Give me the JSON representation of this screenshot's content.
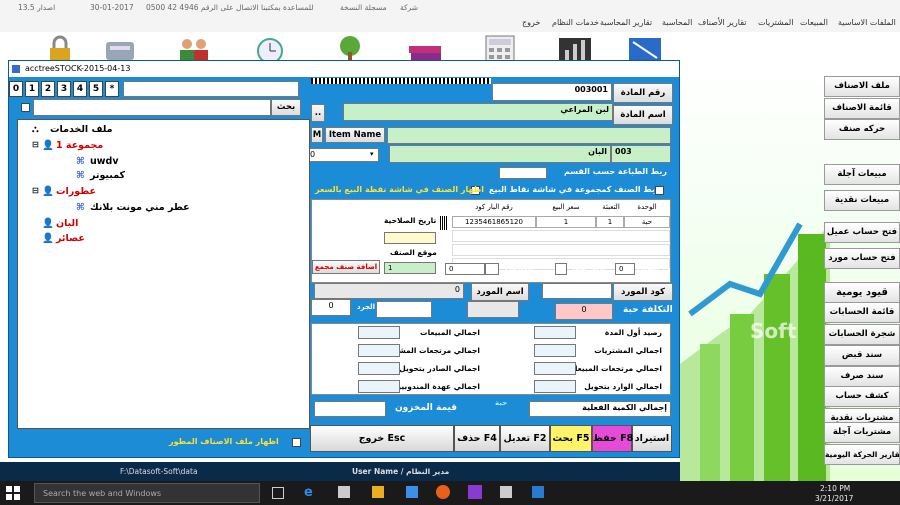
{
  "app_topbar": {
    "version": "اصدار  13.5",
    "date": "30-01-2017",
    "support": "للمساعدة بمكتبنا الاتصال على الرقم 4946 42 0500",
    "copy_label": "مسجلة النسخة",
    "company": "شركة"
  },
  "app_menu": [
    "الملفات الاساسية",
    "المبيعات",
    "المشتريات",
    "تقارير الأصناف",
    "المحاسبة",
    "تقارير المحاسبة",
    "خدمات النظام",
    "خروج"
  ],
  "right_buttons": [
    "ملف الاصناف",
    "قائمة الاصناف",
    "حركه صنف",
    "مبيعات آجلة",
    "مبيعات نقدية",
    "فتح حساب عميل",
    "فتح حساب مورد",
    "قيود يومية",
    "قائمة الحسابات",
    "شجرة الحسابات",
    "سند قبض",
    "سند صرف",
    "كشف حساب",
    "مشتريات نقدية",
    "مشتريات آجلة",
    "تقارير الحركة اليومية"
  ],
  "watermark": "Soft",
  "dialog": {
    "title": "acctreeSTOCK-2015-04-13",
    "num_keys": [
      "0",
      "1",
      "2",
      "3",
      "4",
      "5",
      "*"
    ],
    "search_button": "بحث",
    "tree": {
      "root": "ملف الخدمات",
      "items": [
        {
          "label": "مجموعة 1",
          "color": "#d40000"
        },
        {
          "label": "uwdv",
          "color": "#000000"
        },
        {
          "label": "كمبيوتر",
          "color": "#000000"
        },
        {
          "label": "عطورات",
          "color": "#d40000"
        },
        {
          "label": "عطر مني مونت بلانك",
          "color": "#000000"
        },
        {
          "label": "البان",
          "color": "#d40000"
        },
        {
          "label": "عصائر",
          "color": "#d40000"
        }
      ]
    },
    "show_items_file": "اظهار ملف الاصناف المطور",
    "item_no_label": "رقم المادة",
    "item_no_value": "003001",
    "item_name_label": "اسم المادة",
    "item_name_value": "لبن المراعي",
    "dots_button": "..",
    "item_name_button": "Item Name",
    "m_button": "M",
    "category_code": "003",
    "category_name": "البان",
    "combo_value": "0",
    "print_link_label": "ربط الطباعة حسب القسم",
    "link_group_label": "ربط الصنف كمجموعة في شاشة نقاط البيع",
    "show_in_pos_label": "اظهار الصنف في شاشة نقطة البيع بالسعر",
    "grid_headers": [
      "الوحدة",
      "التعبئة",
      "سعر البيع",
      "رقم البار كود"
    ],
    "grid_row": [
      "حبة",
      "1",
      "1",
      "1235461865120"
    ],
    "expiry_label": "تاريخ الصلاحية",
    "location_label": "موقع الصنف",
    "location_value": "1",
    "add_combo_button": "اضافة صنف مجمع",
    "order_limit_label": "حد الطلب",
    "order_limit_value": "0",
    "min_price_label": "ادنى سعر",
    "rep_label": "المندوب",
    "rep_value": "0",
    "supplier_code_label": "كود المورد",
    "supplier_name_label": "اسم المورد",
    "supplier_value": "0",
    "cost_label": "التكلفة حبة",
    "cost_value": "0",
    "wholesale_label": "الجرد",
    "wholesale_value": "0",
    "stats_right": [
      "رصيد أول المدة",
      "اجمالي المشتريات",
      "اجمالي مرتجعات المبيعات",
      "اجمالي الوارد بتحويل"
    ],
    "stats_left": [
      "اجمالي المبيعات",
      "اجمالي مرتجعات المشتريات",
      "اجمالي الصادر بتحويل",
      "اجمالي عهدة المندوبين"
    ],
    "total_qty_label": "إجمالي الكمية الفعلية",
    "unit_hint": "حبة",
    "stock_value_label": "قيمة المخزون",
    "bottom_buttons": [
      "استيراد",
      "حفظ F8",
      "بحث F5",
      "تعديل F2",
      "حذف F4",
      "خروج Esc"
    ],
    "status_path": "F:\\Datasoft-Soft\\data",
    "status_user_label": "User Name / مدير النظام"
  },
  "taskbar": {
    "search_placeholder": "Search the web and Windows",
    "time": "2:10 PM",
    "date": "3/21/2017"
  },
  "colors": {
    "dialog_bg": "#1d8cd6",
    "green_field": "#c8f0c8",
    "red_label": "#d40000"
  }
}
